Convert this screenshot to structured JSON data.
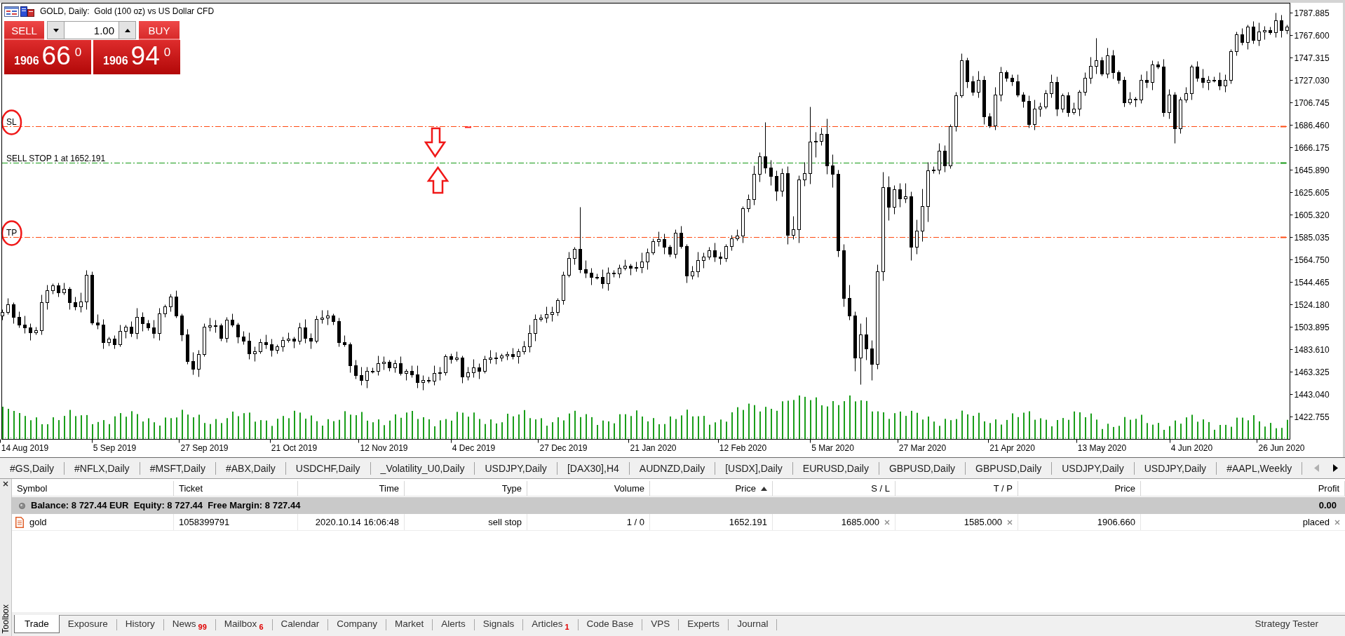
{
  "chart": {
    "title": "GOLD, Daily:  Gold (100 oz) vs US Dollar CFD",
    "trading": {
      "sell_label": "SELL",
      "buy_label": "BUY",
      "lot": "1.00",
      "sell_price": {
        "big_figure": "1906",
        "pips": "66",
        "point": "0"
      },
      "buy_price": {
        "big_figure": "1906",
        "pips": "94",
        "point": "0"
      }
    },
    "order_lines": [
      {
        "kind": "stop_loss",
        "label": "SL",
        "circled": true,
        "arrows": false
      },
      {
        "kind": "pending",
        "label": "SELL STOP 1 at 1652.191",
        "circled": false,
        "arrows": true
      },
      {
        "kind": "take_profit",
        "label": "TP",
        "circled": true,
        "arrows": false
      }
    ],
    "chart_data": {
      "type": "candlestick",
      "categories": [
        null,
        null,
        null,
        null,
        "14 Aug 2019",
        null,
        null,
        null,
        null,
        null,
        null,
        null,
        null,
        null,
        null,
        null,
        null,
        null,
        null,
        null,
        "5 Sep 2019",
        null,
        null,
        null,
        null,
        null,
        null,
        null,
        null,
        null,
        null,
        null,
        null,
        null,
        null,
        null,
        "27 Sep 2019",
        null,
        null,
        null,
        null,
        null,
        null,
        null,
        null,
        null,
        null,
        null,
        null,
        null,
        null,
        null,
        "21 Oct 2019",
        null,
        null,
        null,
        null,
        null,
        null,
        null,
        null,
        null,
        null,
        null,
        null,
        null,
        null,
        null,
        "12 Nov 2019",
        null,
        null,
        null,
        null,
        null,
        null,
        null,
        null,
        null,
        null,
        null,
        null,
        null,
        null,
        null,
        "4 Dec 2019",
        null,
        null,
        null,
        null,
        null,
        null,
        null,
        null,
        null,
        null,
        null,
        null,
        null,
        null,
        null,
        "27 Dec 2019",
        null,
        null,
        null,
        null,
        null,
        null,
        null,
        null,
        null,
        null,
        null,
        null,
        null,
        null,
        null,
        "21 Jan 2020",
        null,
        null,
        null,
        null,
        null,
        null,
        null,
        null,
        null,
        null,
        null,
        null,
        null,
        null,
        null,
        "12 Feb 2020",
        null,
        null,
        null,
        null,
        null,
        null,
        null,
        null,
        null,
        null,
        null,
        null,
        null,
        null,
        null,
        "5 Mar 2020",
        null,
        null,
        null,
        null,
        null,
        null,
        null,
        null,
        null,
        null,
        null,
        null,
        null,
        null,
        null,
        "27 Mar 2020",
        null,
        null,
        null,
        null,
        null,
        null,
        null,
        null,
        null,
        null,
        null,
        null,
        null,
        null,
        null,
        "21 Apr 2020",
        null,
        null,
        null,
        null,
        null,
        null,
        null,
        null,
        null,
        null,
        null,
        null,
        null,
        null,
        null,
        "13 May 2020",
        null,
        null,
        null,
        null,
        null,
        null,
        null,
        null,
        null,
        null,
        null,
        null,
        null,
        null,
        null,
        "4 Jun 2020",
        null,
        null,
        null,
        null,
        null,
        null,
        null,
        null,
        null,
        null,
        null,
        null,
        null,
        null,
        null,
        "26 Jun 2020",
        null
      ],
      "ohlc": [
        [
          1514,
          1520,
          1510,
          1517
        ],
        [
          1517,
          1530,
          1515,
          1524
        ],
        [
          1524,
          1526,
          1507,
          1513
        ],
        [
          1513,
          1518,
          1503,
          1506
        ],
        [
          1506,
          1514,
          1498,
          1503
        ],
        [
          1503,
          1507,
          1492,
          1499
        ],
        [
          1499,
          1504,
          1497,
          1501
        ],
        [
          1501,
          1533,
          1497,
          1526
        ],
        [
          1526,
          1542,
          1520,
          1537
        ],
        [
          1537,
          1543,
          1534,
          1541
        ],
        [
          1541,
          1544,
          1531,
          1535
        ],
        [
          1535,
          1544,
          1533,
          1538
        ],
        [
          1538,
          1540,
          1520,
          1526
        ],
        [
          1526,
          1531,
          1519,
          1522
        ],
        [
          1522,
          1535,
          1517,
          1527
        ],
        [
          1527,
          1555,
          1520,
          1551
        ],
        [
          1551,
          1554,
          1506,
          1508
        ],
        [
          1508,
          1515,
          1502,
          1506
        ],
        [
          1506,
          1511,
          1484,
          1490
        ],
        [
          1490,
          1495,
          1487,
          1493
        ],
        [
          1493,
          1496,
          1484,
          1488
        ],
        [
          1488,
          1506,
          1486,
          1500
        ],
        [
          1500,
          1506,
          1494,
          1504
        ],
        [
          1504,
          1509,
          1495,
          1498
        ],
        [
          1498,
          1521,
          1493,
          1513
        ],
        [
          1513,
          1517,
          1500,
          1507
        ],
        [
          1507,
          1510,
          1501,
          1503
        ],
        [
          1503,
          1510,
          1494,
          1498
        ],
        [
          1498,
          1521,
          1492,
          1516
        ],
        [
          1516,
          1524,
          1513,
          1522
        ],
        [
          1522,
          1534,
          1518,
          1531
        ],
        [
          1531,
          1537,
          1512,
          1514
        ],
        [
          1514,
          1516,
          1491,
          1497
        ],
        [
          1497,
          1502,
          1470,
          1473
        ],
        [
          1473,
          1481,
          1461,
          1466
        ],
        [
          1466,
          1483,
          1459,
          1479
        ],
        [
          1479,
          1507,
          1477,
          1504
        ],
        [
          1504,
          1512,
          1500,
          1505
        ],
        [
          1505,
          1510,
          1499,
          1505
        ],
        [
          1505,
          1507,
          1491,
          1494
        ],
        [
          1494,
          1513,
          1490,
          1510
        ],
        [
          1510,
          1516,
          1504,
          1506
        ],
        [
          1506,
          1508,
          1489,
          1495
        ],
        [
          1495,
          1500,
          1488,
          1491
        ],
        [
          1491,
          1499,
          1475,
          1480
        ],
        [
          1480,
          1486,
          1473,
          1482
        ],
        [
          1482,
          1493,
          1480,
          1490
        ],
        [
          1490,
          1497,
          1484,
          1488
        ],
        [
          1488,
          1493,
          1477,
          1483
        ],
        [
          1483,
          1488,
          1480,
          1486
        ],
        [
          1486,
          1495,
          1482,
          1492
        ],
        [
          1492,
          1499,
          1490,
          1493
        ],
        [
          1493,
          1495,
          1485,
          1491
        ],
        [
          1491,
          1508,
          1488,
          1503
        ],
        [
          1503,
          1511,
          1489,
          1494
        ],
        [
          1494,
          1498,
          1484,
          1491
        ],
        [
          1491,
          1514,
          1489,
          1511
        ],
        [
          1511,
          1519,
          1507,
          1512
        ],
        [
          1512,
          1519,
          1506,
          1514
        ],
        [
          1514,
          1516,
          1506,
          1509
        ],
        [
          1509,
          1512,
          1486,
          1490
        ],
        [
          1490,
          1496,
          1486,
          1488
        ],
        [
          1488,
          1490,
          1463,
          1469
        ],
        [
          1469,
          1474,
          1457,
          1460
        ],
        [
          1460,
          1468,
          1451,
          1456
        ],
        [
          1456,
          1468,
          1449,
          1464
        ],
        [
          1464,
          1467,
          1462,
          1464
        ],
        [
          1464,
          1478,
          1460,
          1471
        ],
        [
          1471,
          1477,
          1465,
          1472
        ],
        [
          1472,
          1474,
          1464,
          1467
        ],
        [
          1467,
          1474,
          1463,
          1471
        ],
        [
          1471,
          1477,
          1460,
          1462
        ],
        [
          1462,
          1466,
          1456,
          1464
        ],
        [
          1464,
          1469,
          1458,
          1461
        ],
        [
          1461,
          1469,
          1449,
          1454
        ],
        [
          1454,
          1460,
          1447,
          1456
        ],
        [
          1456,
          1459,
          1453,
          1455
        ],
        [
          1455,
          1469,
          1451,
          1462
        ],
        [
          1462,
          1468,
          1456,
          1463
        ],
        [
          1463,
          1479,
          1460,
          1477
        ],
        [
          1477,
          1480,
          1471,
          1475
        ],
        [
          1475,
          1482,
          1473,
          1476
        ],
        [
          1476,
          1478,
          1453,
          1459
        ],
        [
          1459,
          1468,
          1456,
          1463
        ],
        [
          1463,
          1475,
          1458,
          1467
        ],
        [
          1467,
          1471,
          1457,
          1464
        ],
        [
          1464,
          1478,
          1462,
          1475
        ],
        [
          1475,
          1483,
          1471,
          1476
        ],
        [
          1476,
          1481,
          1470,
          1476
        ],
        [
          1476,
          1480,
          1473,
          1478
        ],
        [
          1478,
          1482,
          1474,
          1479
        ],
        [
          1479,
          1485,
          1475,
          1477
        ],
        [
          1477,
          1484,
          1471,
          1482
        ],
        [
          1482,
          1491,
          1479,
          1486
        ],
        [
          1486,
          1506,
          1481,
          1498
        ],
        [
          1498,
          1515,
          1491,
          1511
        ],
        [
          1511,
          1515,
          1509,
          1512
        ],
        [
          1512,
          1522,
          1508,
          1515
        ],
        [
          1515,
          1522,
          1509,
          1517
        ],
        [
          1517,
          1530,
          1514,
          1528
        ],
        [
          1528,
          1554,
          1524,
          1551
        ],
        [
          1551,
          1572,
          1549,
          1566
        ],
        [
          1566,
          1576,
          1560,
          1574
        ],
        [
          1574,
          1612,
          1553,
          1556
        ],
        [
          1556,
          1564,
          1548,
          1553
        ],
        [
          1553,
          1557,
          1542,
          1549
        ],
        [
          1549,
          1552,
          1547,
          1549
        ],
        [
          1549,
          1556,
          1539,
          1543
        ],
        [
          1543,
          1558,
          1537,
          1553
        ],
        [
          1553,
          1555,
          1549,
          1552
        ],
        [
          1552,
          1560,
          1548,
          1557
        ],
        [
          1557,
          1565,
          1555,
          1559
        ],
        [
          1559,
          1561,
          1551,
          1557
        ],
        [
          1557,
          1563,
          1554,
          1558
        ],
        [
          1558,
          1571,
          1553,
          1563
        ],
        [
          1563,
          1575,
          1556,
          1571
        ],
        [
          1571,
          1584,
          1569,
          1581
        ],
        [
          1581,
          1590,
          1577,
          1583
        ],
        [
          1583,
          1588,
          1570,
          1576
        ],
        [
          1576,
          1578,
          1567,
          1570
        ],
        [
          1570,
          1592,
          1566,
          1589
        ],
        [
          1589,
          1595,
          1575,
          1577
        ],
        [
          1577,
          1579,
          1544,
          1550
        ],
        [
          1550,
          1559,
          1547,
          1554
        ],
        [
          1554,
          1572,
          1549,
          1564
        ],
        [
          1564,
          1571,
          1557,
          1567
        ],
        [
          1567,
          1576,
          1565,
          1573
        ],
        [
          1573,
          1580,
          1563,
          1567
        ],
        [
          1567,
          1572,
          1560,
          1566
        ],
        [
          1566,
          1579,
          1563,
          1577
        ],
        [
          1577,
          1587,
          1573,
          1584
        ],
        [
          1584,
          1592,
          1582,
          1586
        ],
        [
          1586,
          1613,
          1580,
          1611
        ],
        [
          1611,
          1624,
          1608,
          1619
        ],
        [
          1619,
          1650,
          1614,
          1642
        ],
        [
          1642,
          1662,
          1635,
          1658
        ],
        [
          1658,
          1689,
          1643,
          1648
        ],
        [
          1648,
          1655,
          1632,
          1640
        ],
        [
          1640,
          1645,
          1618,
          1627
        ],
        [
          1627,
          1647,
          1622,
          1643
        ],
        [
          1643,
          1649,
          1579,
          1587
        ],
        [
          1587,
          1604,
          1583,
          1592
        ],
        [
          1592,
          1641,
          1580,
          1637
        ],
        [
          1637,
          1653,
          1631,
          1643
        ],
        [
          1643,
          1703,
          1633,
          1671
        ],
        [
          1671,
          1680,
          1657,
          1672
        ],
        [
          1672,
          1684,
          1668,
          1678
        ],
        [
          1678,
          1692,
          1642,
          1650
        ],
        [
          1650,
          1660,
          1630,
          1642
        ],
        [
          1642,
          1646,
          1567,
          1573
        ],
        [
          1573,
          1579,
          1522,
          1530
        ],
        [
          1530,
          1542,
          1510,
          1514
        ],
        [
          1514,
          1518,
          1464,
          1476
        ],
        [
          1476,
          1507,
          1452,
          1497
        ],
        [
          1497,
          1513,
          1474,
          1484
        ],
        [
          1484,
          1492,
          1456,
          1470
        ],
        [
          1470,
          1560,
          1466,
          1554
        ],
        [
          1554,
          1644,
          1546,
          1630
        ],
        [
          1630,
          1640,
          1600,
          1612
        ],
        [
          1612,
          1632,
          1606,
          1628
        ],
        [
          1628,
          1634,
          1612,
          1620
        ],
        [
          1620,
          1634,
          1616,
          1622
        ],
        [
          1622,
          1626,
          1564,
          1576
        ],
        [
          1576,
          1601,
          1570,
          1591
        ],
        [
          1591,
          1629,
          1581,
          1613
        ],
        [
          1613,
          1653,
          1599,
          1645
        ],
        [
          1645,
          1649,
          1643,
          1646
        ],
        [
          1646,
          1670,
          1642,
          1663
        ],
        [
          1663,
          1668,
          1644,
          1650
        ],
        [
          1650,
          1687,
          1647,
          1685
        ],
        [
          1685,
          1716,
          1681,
          1713
        ],
        [
          1713,
          1751,
          1711,
          1745
        ],
        [
          1745,
          1747,
          1720,
          1726
        ],
        [
          1726,
          1731,
          1713,
          1716
        ],
        [
          1716,
          1735,
          1711,
          1727
        ],
        [
          1727,
          1731,
          1687,
          1694
        ],
        [
          1694,
          1697,
          1684,
          1686
        ],
        [
          1686,
          1721,
          1682,
          1714
        ],
        [
          1714,
          1739,
          1708,
          1734
        ],
        [
          1734,
          1736,
          1726,
          1729
        ],
        [
          1729,
          1732,
          1722,
          1726
        ],
        [
          1726,
          1732,
          1712,
          1714
        ],
        [
          1714,
          1716,
          1702,
          1708
        ],
        [
          1708,
          1713,
          1684,
          1687
        ],
        [
          1687,
          1709,
          1682,
          1701
        ],
        [
          1701,
          1707,
          1694,
          1703
        ],
        [
          1703,
          1718,
          1701,
          1715
        ],
        [
          1715,
          1732,
          1711,
          1725
        ],
        [
          1725,
          1730,
          1695,
          1701
        ],
        [
          1701,
          1715,
          1698,
          1713
        ],
        [
          1713,
          1716,
          1694,
          1698
        ],
        [
          1698,
          1707,
          1696,
          1701
        ],
        [
          1701,
          1718,
          1695,
          1716
        ],
        [
          1716,
          1734,
          1713,
          1729
        ],
        [
          1729,
          1748,
          1724,
          1740
        ],
        [
          1740,
          1765,
          1733,
          1745
        ],
        [
          1745,
          1748,
          1731,
          1733
        ],
        [
          1733,
          1756,
          1729,
          1749
        ],
        [
          1749,
          1754,
          1728,
          1734
        ],
        [
          1734,
          1736,
          1724,
          1727
        ],
        [
          1727,
          1730,
          1703,
          1707
        ],
        [
          1707,
          1716,
          1705,
          1710
        ],
        [
          1710,
          1712,
          1703,
          1709
        ],
        [
          1709,
          1732,
          1706,
          1727
        ],
        [
          1727,
          1735,
          1720,
          1725
        ],
        [
          1725,
          1745,
          1718,
          1741
        ],
        [
          1741,
          1744,
          1737,
          1739
        ],
        [
          1739,
          1746,
          1694,
          1698
        ],
        [
          1698,
          1719,
          1692,
          1714
        ],
        [
          1714,
          1716,
          1670,
          1683
        ],
        [
          1683,
          1712,
          1679,
          1709
        ],
        [
          1709,
          1721,
          1707,
          1715
        ],
        [
          1715,
          1741,
          1709,
          1739
        ],
        [
          1739,
          1744,
          1726,
          1729
        ],
        [
          1729,
          1737,
          1720,
          1725
        ],
        [
          1725,
          1731,
          1718,
          1727
        ],
        [
          1727,
          1730,
          1725,
          1727
        ],
        [
          1727,
          1734,
          1718,
          1722
        ],
        [
          1722,
          1732,
          1716,
          1727
        ],
        [
          1727,
          1755,
          1724,
          1753
        ],
        [
          1753,
          1771,
          1749,
          1768
        ],
        [
          1768,
          1774,
          1759,
          1761
        ],
        [
          1761,
          1777,
          1755,
          1775
        ],
        [
          1775,
          1780,
          1760,
          1763
        ],
        [
          1763,
          1779,
          1758,
          1771
        ],
        [
          1771,
          1776,
          1764,
          1772
        ],
        [
          1772,
          1775,
          1768,
          1770
        ],
        [
          1770,
          1788,
          1766,
          1781
        ],
        [
          1781,
          1786,
          1766,
          1772
        ],
        [
          1772,
          1777,
          1769,
          1775
        ]
      ],
      "ylim": [
        1402.47,
        1796.76
      ],
      "yticks": [
        {
          "value": 1787.885,
          "label": "1787.885"
        },
        {
          "value": 1767.6,
          "label": "1767.600"
        },
        {
          "value": 1747.315,
          "label": "1747.315"
        },
        {
          "value": 1727.03,
          "label": "1727.030"
        },
        {
          "value": 1706.745,
          "label": "1706.745"
        },
        {
          "value": 1686.46,
          "label": "1686.460"
        },
        {
          "value": 1666.175,
          "label": "1666.175"
        },
        {
          "value": 1645.89,
          "label": "1645.890"
        },
        {
          "value": 1625.605,
          "label": "1625.605"
        },
        {
          "value": 1605.32,
          "label": "1605.320"
        },
        {
          "value": 1585.035,
          "label": "1585.035"
        },
        {
          "value": 1564.75,
          "label": "1564.750"
        },
        {
          "value": 1544.465,
          "label": "1544.465"
        },
        {
          "value": 1524.18,
          "label": "1524.180"
        },
        {
          "value": 1503.895,
          "label": "1503.895"
        },
        {
          "value": 1483.61,
          "label": "1483.610"
        },
        {
          "value": 1463.325,
          "label": "1463.325"
        },
        {
          "value": 1443.04,
          "label": "1443.040"
        },
        {
          "value": 1422.755,
          "label": "1422.755"
        }
      ]
    }
  },
  "chart_tabs": [
    "#GS,Daily",
    "#NFLX,Daily",
    "#MSFT,Daily",
    "#ABX,Daily",
    "USDCHF,Daily",
    "_Volatility_U0,Daily",
    "USDJPY,Daily",
    "[DAX30],H4",
    "AUDNZD,Daily",
    "[USDX],Daily",
    "EURUSD,Daily",
    "GBPUSD,Daily",
    "GBPUSD,Daily",
    "USDJPY,Daily",
    "USDJPY,Daily",
    "#AAPL,Weekly"
  ],
  "tab_scroll": [
    {
      "kind": "left",
      "disabled": true
    },
    {
      "kind": "right",
      "disabled": false
    }
  ],
  "terminal": {
    "side_label": "Toolbox",
    "columns": [
      {
        "label": "Symbol",
        "sorted": false
      },
      {
        "label": "Ticket",
        "sorted": false
      },
      {
        "label": "Time",
        "sorted": false
      },
      {
        "label": "Type",
        "sorted": false
      },
      {
        "label": "Volume",
        "sorted": false
      },
      {
        "label": "Price",
        "sorted": true
      },
      {
        "label": "S / L",
        "sorted": false
      },
      {
        "label": "T / P",
        "sorted": false
      },
      {
        "label": "Price",
        "sorted": false
      },
      {
        "label": "Profit",
        "sorted": false
      }
    ],
    "balance": {
      "text": "Balance: 8 727.44 EUR  Equity: 8 727.44  Free Margin: 8 727.44",
      "profit": "0.00"
    },
    "rows": [
      {
        "cells": [
          {
            "text": "gold",
            "removable": false
          },
          {
            "text": "1058399791",
            "removable": false
          },
          {
            "text": "2020.10.14 16:06:48",
            "removable": false
          },
          {
            "text": "sell stop",
            "removable": false
          },
          {
            "text": "1 / 0",
            "removable": false
          },
          {
            "text": "1652.191",
            "removable": false
          },
          {
            "text": "1685.000",
            "removable": true
          },
          {
            "text": "1585.000",
            "removable": true
          },
          {
            "text": "1906.660",
            "removable": false
          },
          {
            "text": "placed",
            "removable": true
          }
        ]
      }
    ],
    "tabs": [
      {
        "label": "Trade",
        "selected": true
      },
      {
        "label": "Exposure",
        "selected": false
      },
      {
        "label": "History",
        "selected": false
      },
      {
        "label": "News",
        "count": "99",
        "selected": false
      },
      {
        "label": "Mailbox",
        "count": "6",
        "selected": false
      },
      {
        "label": "Calendar",
        "selected": false
      },
      {
        "label": "Company",
        "selected": false
      },
      {
        "label": "Market",
        "selected": false
      },
      {
        "label": "Alerts",
        "selected": false
      },
      {
        "label": "Signals",
        "selected": false
      },
      {
        "label": "Articles",
        "count": "1",
        "selected": false
      },
      {
        "label": "Code Base",
        "selected": false
      },
      {
        "label": "VPS",
        "selected": false
      },
      {
        "label": "Experts",
        "selected": false
      },
      {
        "label": "Journal",
        "selected": false
      }
    ],
    "extra_tab": "Strategy Tester"
  }
}
